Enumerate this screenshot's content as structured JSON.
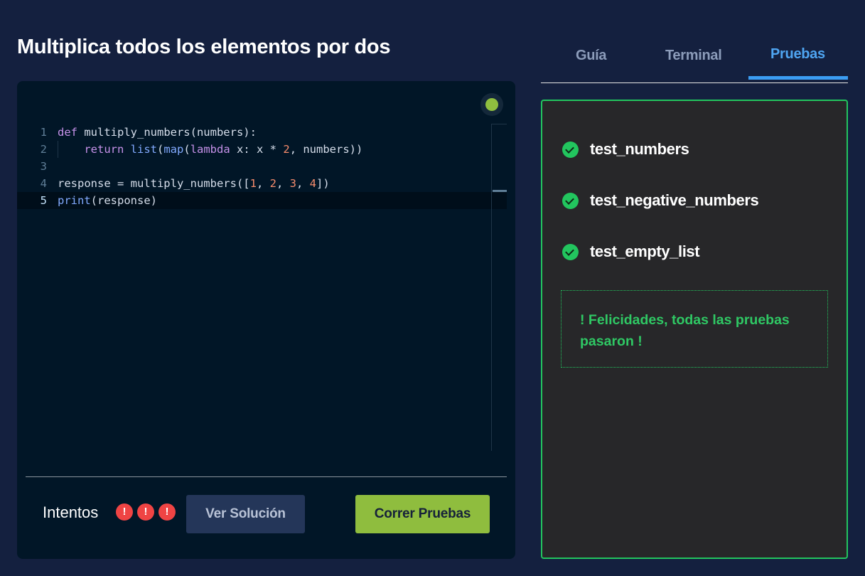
{
  "title": "Multiplica todos los elementos por dos",
  "editor": {
    "lines": [
      {
        "number": "1",
        "tokens": [
          {
            "t": "def",
            "c": "kw"
          },
          {
            "t": " multiply_numbers(numbers):",
            "c": ""
          }
        ]
      },
      {
        "number": "2",
        "tokens": [
          {
            "t": "    ",
            "c": ""
          },
          {
            "t": "return",
            "c": "kw"
          },
          {
            "t": " ",
            "c": ""
          },
          {
            "t": "list",
            "c": "fn"
          },
          {
            "t": "(",
            "c": ""
          },
          {
            "t": "map",
            "c": "fn"
          },
          {
            "t": "(",
            "c": ""
          },
          {
            "t": "lambda",
            "c": "kw"
          },
          {
            "t": " x: x * ",
            "c": ""
          },
          {
            "t": "2",
            "c": "num"
          },
          {
            "t": ", numbers))",
            "c": ""
          }
        ]
      },
      {
        "number": "3",
        "tokens": []
      },
      {
        "number": "4",
        "tokens": [
          {
            "t": "response = multiply_numbers([",
            "c": ""
          },
          {
            "t": "1",
            "c": "num"
          },
          {
            "t": ", ",
            "c": ""
          },
          {
            "t": "2",
            "c": "num"
          },
          {
            "t": ", ",
            "c": ""
          },
          {
            "t": "3",
            "c": "num"
          },
          {
            "t": ", ",
            "c": ""
          },
          {
            "t": "4",
            "c": "num"
          },
          {
            "t": "])",
            "c": ""
          }
        ]
      },
      {
        "number": "5",
        "tokens": [
          {
            "t": "print",
            "c": "fn"
          },
          {
            "t": "(response)",
            "c": ""
          }
        ]
      }
    ],
    "active_line": 5,
    "status_color": "#8fbf3f"
  },
  "footer": {
    "attempts_label": "Intentos",
    "attempt_marks": [
      "!",
      "!",
      "!"
    ],
    "attempt_mark_icon": "error-circle-icon",
    "solution_label": "Ver Solución",
    "run_label": "Correr Pruebas"
  },
  "tabs": [
    {
      "label": "Guía",
      "active": false
    },
    {
      "label": "Terminal",
      "active": false
    },
    {
      "label": "Pruebas",
      "active": true
    }
  ],
  "tests": [
    {
      "name": "test_numbers",
      "status": "passed",
      "icon": "check-circle-icon"
    },
    {
      "name": "test_negative_numbers",
      "status": "passed",
      "icon": "check-circle-icon"
    },
    {
      "name": "test_empty_list",
      "status": "passed",
      "icon": "check-circle-icon"
    }
  ],
  "success_message": "! Felicidades, todas las pruebas pasaron !",
  "colors": {
    "accent_green": "#22c55e",
    "run_button": "#8fbd3e",
    "tab_active": "#3b9df3",
    "error": "#ef4444"
  }
}
